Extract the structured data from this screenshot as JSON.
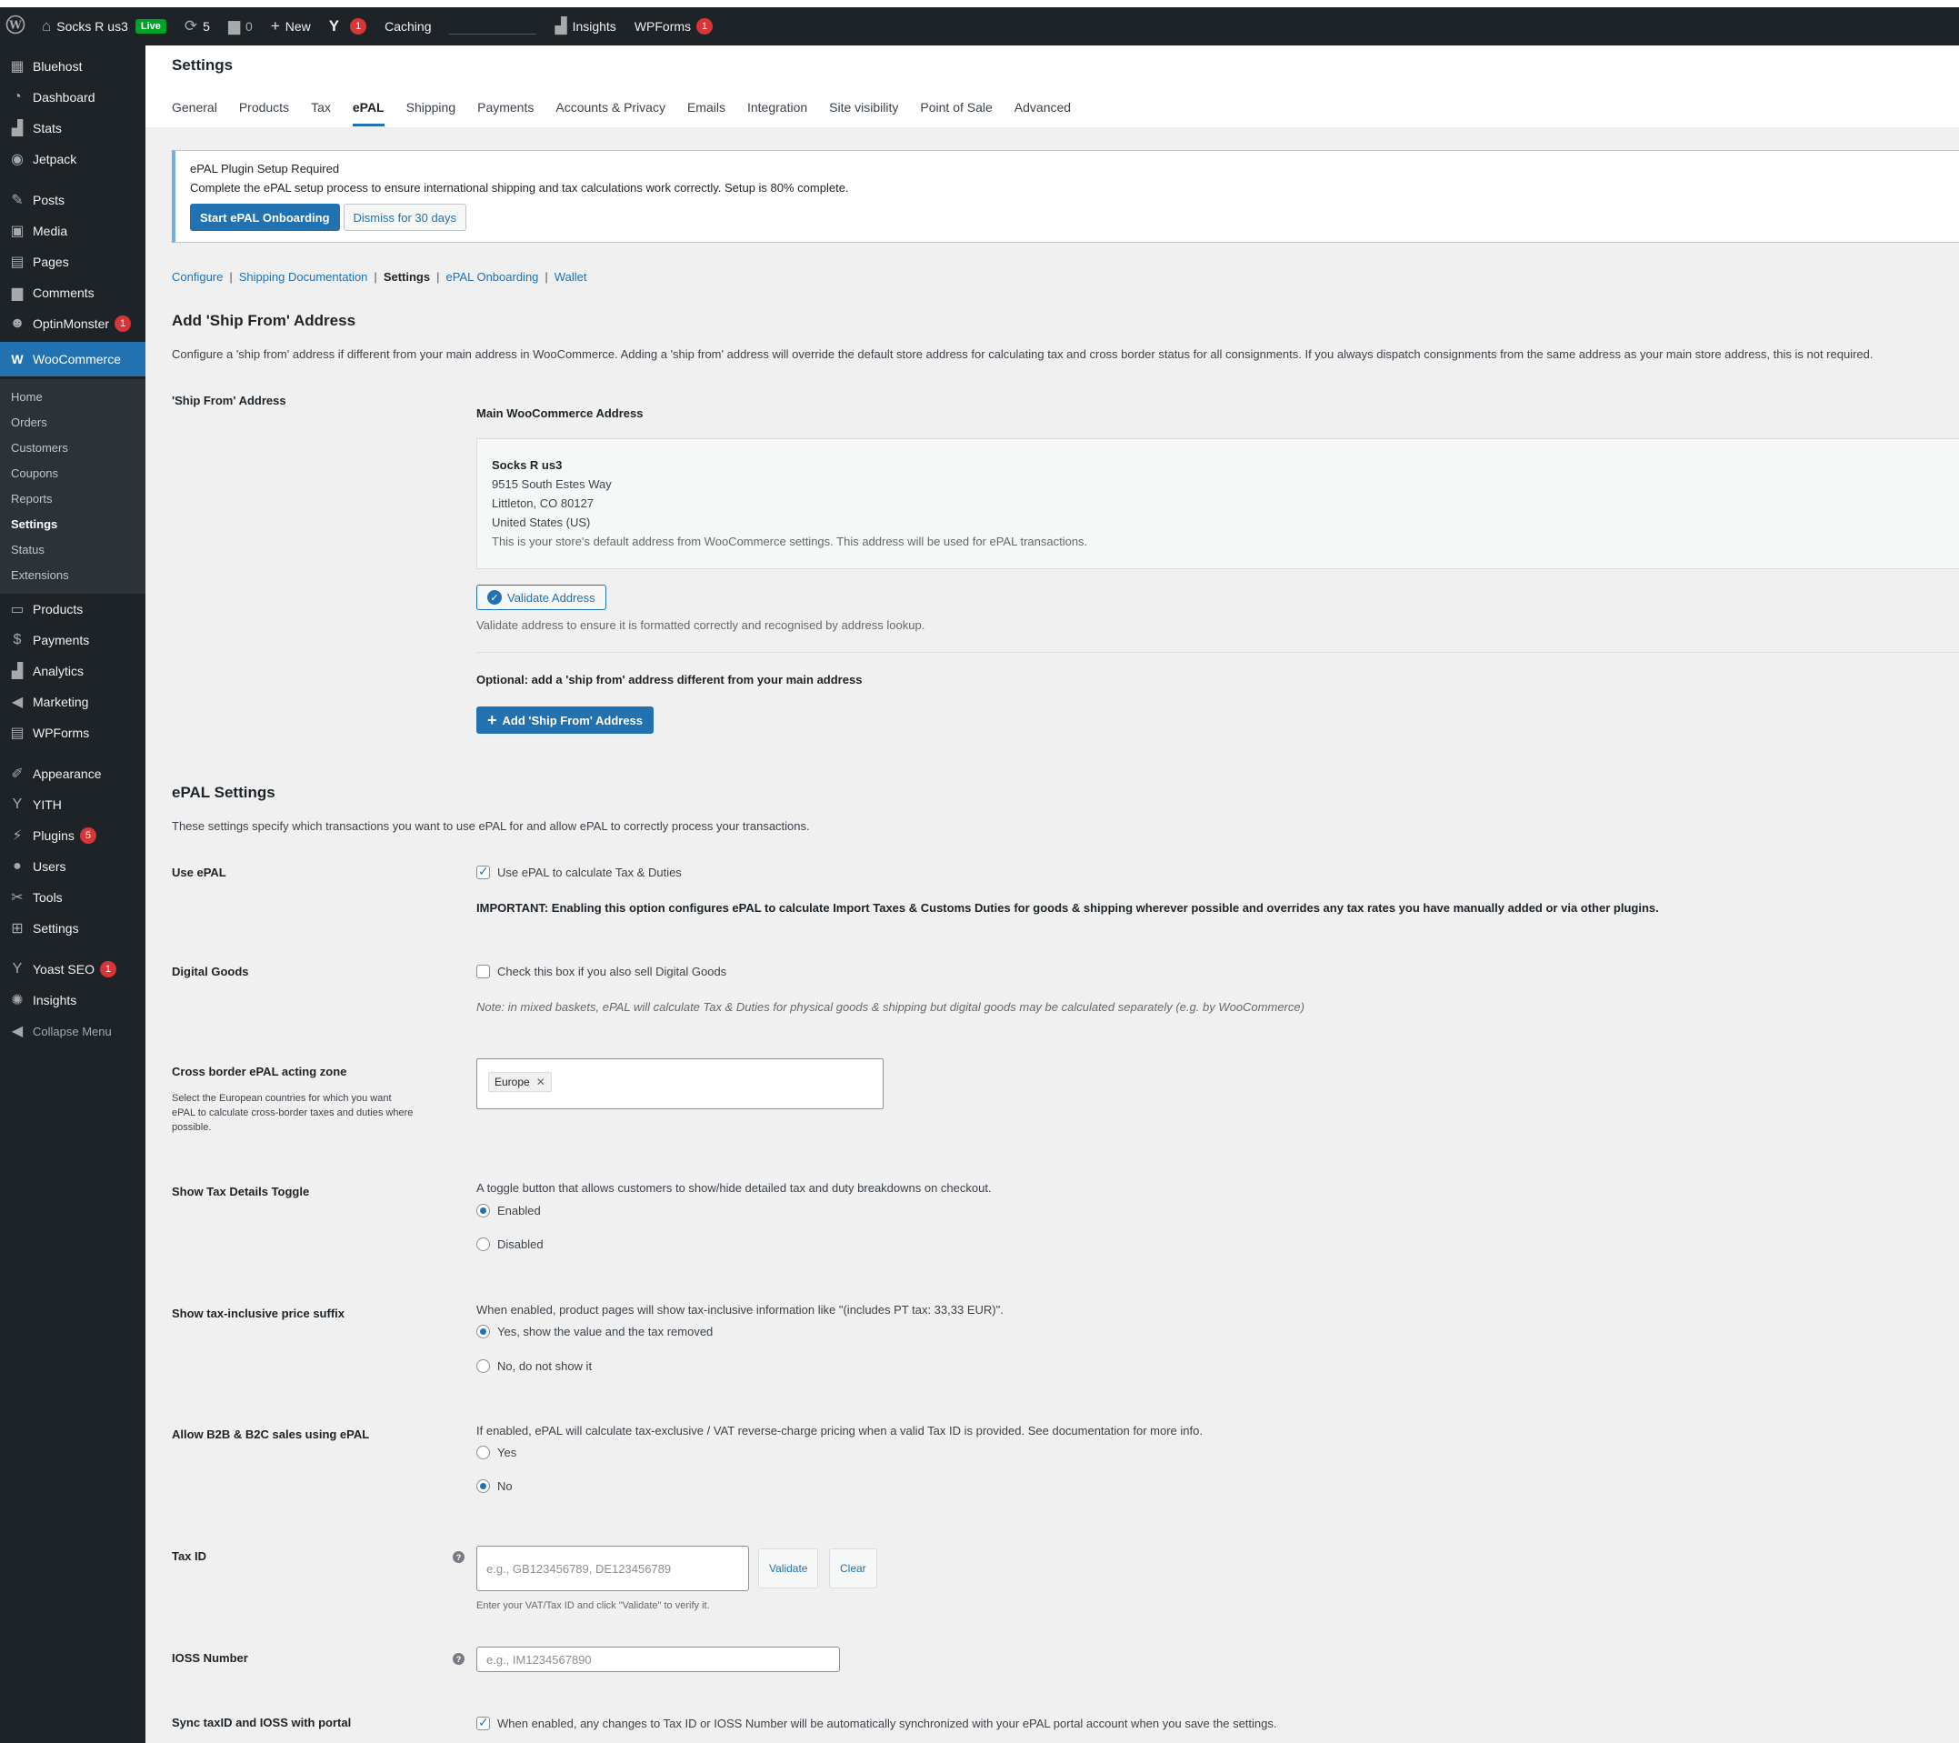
{
  "adminbar": {
    "site_name": "Socks R us3",
    "live": "Live",
    "updates_count": "5",
    "comments_count": "0",
    "new_label": "New",
    "yoast_badge": "1",
    "caching": "Caching",
    "insights": "Insights",
    "wpforms": "WPForms",
    "wpforms_badge": "1"
  },
  "sidebar": {
    "items_top": [
      {
        "label": "Bluehost",
        "icon": "grid-icon"
      },
      {
        "label": "Dashboard",
        "icon": "dashboard-icon"
      },
      {
        "label": "Stats",
        "icon": "stats-icon"
      },
      {
        "label": "Jetpack",
        "icon": "jetpack-icon"
      }
    ],
    "items_content": [
      {
        "label": "Posts",
        "icon": "pin-icon"
      },
      {
        "label": "Media",
        "icon": "media-icon"
      },
      {
        "label": "Pages",
        "icon": "pages-icon"
      },
      {
        "label": "Comments",
        "icon": "comment-icon"
      },
      {
        "label": "OptinMonster",
        "icon": "optinmonster-icon",
        "badge": "1"
      }
    ],
    "woocommerce": "WooCommerce",
    "woo_sub": [
      "Home",
      "Orders",
      "Customers",
      "Coupons",
      "Reports",
      "Settings",
      "Status",
      "Extensions"
    ],
    "items_shop": [
      {
        "label": "Products",
        "icon": "products-icon"
      },
      {
        "label": "Payments",
        "icon": "payments-icon"
      },
      {
        "label": "Analytics",
        "icon": "analytics-icon"
      },
      {
        "label": "Marketing",
        "icon": "marketing-icon"
      },
      {
        "label": "WPForms",
        "icon": "wpforms-icon"
      }
    ],
    "items_admin": [
      {
        "label": "Appearance",
        "icon": "appearance-icon"
      },
      {
        "label": "YITH",
        "icon": "yith-icon"
      },
      {
        "label": "Plugins",
        "icon": "plugins-icon",
        "badge": "5"
      },
      {
        "label": "Users",
        "icon": "users-icon"
      },
      {
        "label": "Tools",
        "icon": "tools-icon"
      },
      {
        "label": "Settings",
        "icon": "settings-icon"
      }
    ],
    "items_bottom": [
      {
        "label": "Yoast SEO",
        "icon": "yoast-icon",
        "badge": "1"
      },
      {
        "label": "Insights",
        "icon": "insights-icon"
      }
    ],
    "collapse": "Collapse Menu"
  },
  "header": {
    "title": "Settings",
    "tabs": [
      "General",
      "Products",
      "Tax",
      "ePAL",
      "Shipping",
      "Payments",
      "Accounts & Privacy",
      "Emails",
      "Integration",
      "Site visibility",
      "Point of Sale",
      "Advanced"
    ],
    "active_tab": "ePAL"
  },
  "notice": {
    "title": "ePAL Plugin Setup Required",
    "text": "Complete the ePAL setup process to ensure international shipping and tax calculations work correctly. Setup is 80% complete.",
    "primary": "Start ePAL Onboarding",
    "secondary": "Dismiss for 30 days"
  },
  "subnav": {
    "configure": "Configure",
    "shipping_docs": "Shipping Documentation",
    "settings": "Settings",
    "onboarding": "ePAL Onboarding",
    "wallet": "Wallet"
  },
  "ship_from": {
    "title": "Add 'Ship From' Address",
    "desc": "Configure a 'ship from' address if different from your main address in WooCommerce. Adding a 'ship from' address will override the default store address for calculating tax and cross border status for all consignments. If you always dispatch consignments from the same address as your main store address, this is not required.",
    "label": "'Ship From' Address",
    "main_label": "Main WooCommerce Address",
    "address": {
      "name": "Socks R us3",
      "line1": "9515 South Estes Way",
      "line2": "Littleton, CO 80127",
      "country": "United States (US)",
      "note": "This is your store's default address from WooCommerce settings. This address will be used for ePAL transactions."
    },
    "validate_btn": "Validate Address",
    "validate_help": "Validate address to ensure it is formatted correctly and recognised by address lookup.",
    "optional_label": "Optional: add a 'ship from' address different from your main address",
    "add_btn": "Add 'Ship From' Address"
  },
  "epal_settings": {
    "title": "ePAL Settings",
    "desc": "These settings specify which transactions you want to use ePAL for and allow ePAL to correctly process your transactions.",
    "use_epal": {
      "label": "Use ePAL",
      "checkbox": "Use ePAL to calculate Tax & Duties",
      "checked": true,
      "important": "IMPORTANT: Enabling this option configures ePAL to calculate Import Taxes & Customs Duties for goods & shipping wherever possible and overrides any tax rates you have manually added or via other plugins."
    },
    "digital_goods": {
      "label": "Digital Goods",
      "checkbox": "Check this box if you also sell Digital Goods",
      "checked": false,
      "note": "Note: in mixed baskets, ePAL will calculate Tax & Duties for physical goods & shipping but digital goods may be calculated separately (e.g. by WooCommerce)"
    },
    "zone": {
      "label": "Cross border ePAL acting zone",
      "desc": "Select the European countries for which you want ePAL to calculate cross-border taxes and duties where possible.",
      "tag": "Europe"
    },
    "tax_toggle": {
      "label": "Show Tax Details Toggle",
      "desc": "A toggle button that allows customers to show/hide detailed tax and duty breakdowns on checkout.",
      "options": [
        "Enabled",
        "Disabled"
      ],
      "selected": "Enabled"
    },
    "price_suffix": {
      "label": "Show tax-inclusive price suffix",
      "desc": "When enabled, product pages will show tax-inclusive information like \"(includes PT tax: 33,33 EUR)\".",
      "options": [
        "Yes, show the value and the tax removed",
        "No, do not show it"
      ],
      "selected": "Yes, show the value and the tax removed"
    },
    "b2b": {
      "label": "Allow B2B & B2C sales using ePAL",
      "desc": "If enabled, ePAL will calculate tax-exclusive / VAT reverse-charge pricing when a valid Tax ID is provided. See documentation for more info.",
      "options": [
        "Yes",
        "No"
      ],
      "selected": "No"
    },
    "tax_id": {
      "label": "Tax ID",
      "placeholder": "e.g., GB123456789, DE123456789",
      "validate": "Validate",
      "clear": "Clear",
      "help": "Enter your VAT/Tax ID and click \"Validate\" to verify it."
    },
    "ioss": {
      "label": "IOSS Number",
      "placeholder": "e.g., IM1234567890"
    },
    "sync": {
      "label": "Sync taxID and IOSS with portal",
      "checkbox": "When enabled, any changes to Tax ID or IOSS Number will be automatically synchronized with your ePAL portal account when you save the settings.",
      "checked": true
    }
  }
}
